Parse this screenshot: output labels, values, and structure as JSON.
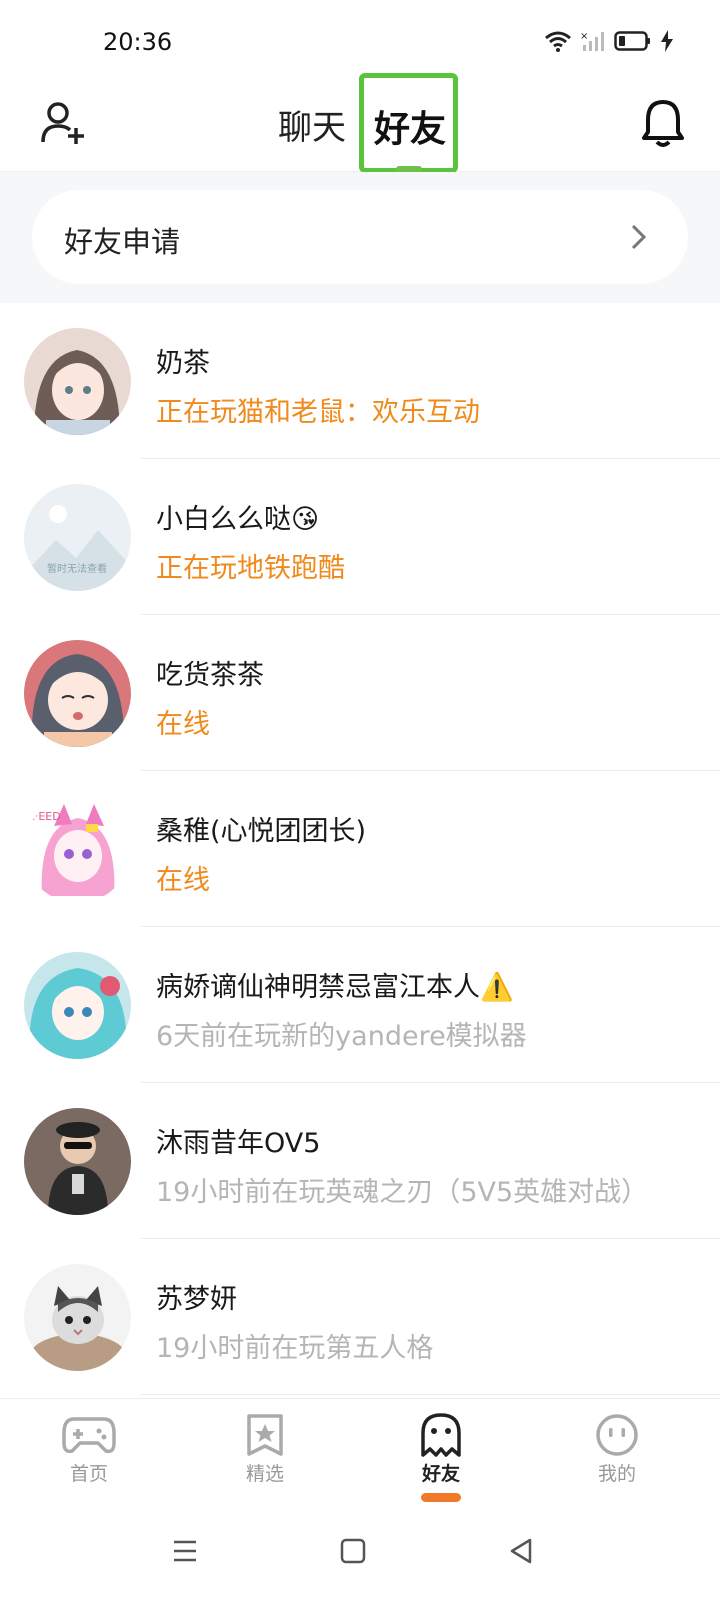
{
  "status_bar": {
    "time": "20:36",
    "icons": [
      "wifi-icon",
      "signal-icon",
      "battery-icon",
      "charging-icon"
    ]
  },
  "header": {
    "tabs": [
      {
        "label": "聊天",
        "active": false
      },
      {
        "label": "好友",
        "active": true
      }
    ],
    "left_icon": "add-friend-icon",
    "right_icon": "bell-icon"
  },
  "friend_requests": {
    "label": "好友申请"
  },
  "friends": [
    {
      "name": "奶茶",
      "status": "正在玩猫和老鼠：欢乐互动",
      "state": "active"
    },
    {
      "name": "小白么么哒😘",
      "status": "正在玩地铁跑酷",
      "state": "active"
    },
    {
      "name": "吃货茶茶",
      "status": "在线",
      "state": "active"
    },
    {
      "name": "桑稚(心悦团团长)",
      "status": "在线",
      "state": "active"
    },
    {
      "name": "病娇谪仙神明禁忌富江本人⚠️",
      "status": "6天前在玩新的yandere模拟器",
      "state": "idle"
    },
    {
      "name": "沐雨昔年OV5",
      "status": "19小时前在玩英魂之刃（5V5英雄对战）",
      "state": "idle"
    },
    {
      "name": "苏梦妍",
      "status": "19小时前在玩第五人格",
      "state": "idle"
    }
  ],
  "placeholder_avatar_text": "暂时无法查看",
  "bottom_nav": [
    {
      "label": "首页",
      "icon": "gamepad-icon",
      "active": false
    },
    {
      "label": "精选",
      "icon": "star-bookmark-icon",
      "active": false
    },
    {
      "label": "好友",
      "icon": "ghost-icon",
      "active": true
    },
    {
      "label": "我的",
      "icon": "face-icon",
      "active": false
    }
  ],
  "colors": {
    "accent_orange": "#f08a1c",
    "highlight_green": "#5bc23c",
    "idle_gray": "#b5b5b5"
  }
}
